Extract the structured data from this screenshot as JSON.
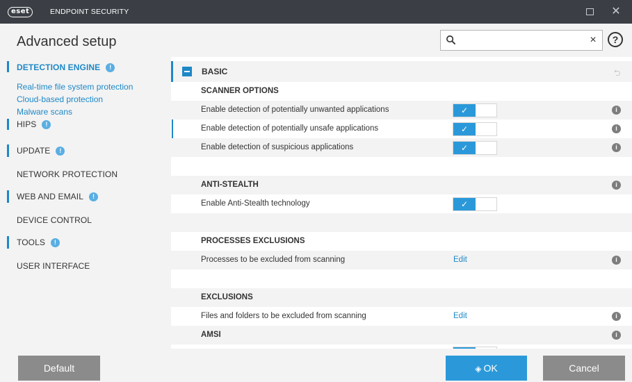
{
  "titlebar": {
    "logo_text": "eset",
    "product_name": "ENDPOINT SECURITY",
    "maximize_glyph": "",
    "close_glyph": "✕"
  },
  "header": {
    "title": "Advanced setup",
    "search": {
      "value": "",
      "placeholder": "",
      "clear_glyph": "×"
    },
    "help_glyph": "?"
  },
  "sidebar": {
    "items": [
      {
        "label": "DETECTION ENGINE",
        "badge": "!",
        "active": true
      },
      {
        "label": "HIPS",
        "badge": "!"
      },
      {
        "label": "UPDATE",
        "badge": "!"
      },
      {
        "label": "NETWORK PROTECTION"
      },
      {
        "label": "WEB AND EMAIL",
        "badge": "!"
      },
      {
        "label": "DEVICE CONTROL"
      },
      {
        "label": "TOOLS",
        "badge": "!"
      },
      {
        "label": "USER INTERFACE"
      }
    ],
    "subitems": [
      "Real-time file system protection",
      "Cloud-based protection",
      "Malware scans"
    ]
  },
  "content": {
    "basic": {
      "label": "BASIC",
      "revert_glyph": "⮌"
    },
    "sections": {
      "scanner_options": "SCANNER OPTIONS",
      "anti_stealth": "ANTI-STEALTH",
      "processes_exclusions": "PROCESSES EXCLUSIONS",
      "exclusions": "EXCLUSIONS",
      "amsi": "AMSI"
    },
    "rows": {
      "pua": {
        "label": "Enable detection of potentially unwanted applications",
        "enabled": true
      },
      "unsafe": {
        "label": "Enable detection of potentially unsafe applications",
        "enabled": true
      },
      "suspicious": {
        "label": "Enable detection of suspicious applications",
        "enabled": true
      },
      "anti_stealth": {
        "label": "Enable Anti-Stealth technology",
        "enabled": true
      },
      "processes": {
        "label": "Processes to be excluded from scanning",
        "action": "Edit"
      },
      "files": {
        "label": "Files and folders to be excluded from scanning",
        "action": "Edit"
      }
    },
    "toggle_check_glyph": "✓",
    "info_glyph": "i"
  },
  "footer": {
    "default_label": "Default",
    "ok_label": "OK",
    "cancel_label": "Cancel"
  },
  "colors": {
    "accent": "#2b99d9",
    "titlebar": "#3b3f45",
    "panel": "#f3f3f3",
    "button_gray": "#8b8b8b"
  },
  "icons": {
    "search": "search-icon",
    "help": "help-icon",
    "info": "info-icon",
    "collapse": "collapse-icon",
    "ok": "shield-icon"
  }
}
